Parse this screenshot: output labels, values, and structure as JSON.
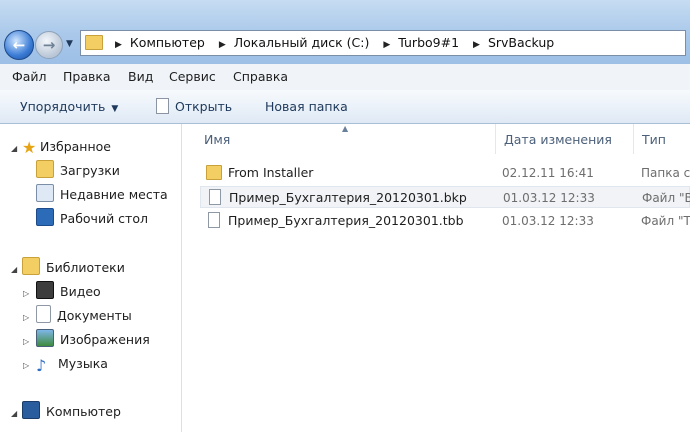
{
  "address": {
    "crumbs": [
      "Компьютер",
      "Локальный диск (C:)",
      "Turbo9#1",
      "SrvBackup"
    ]
  },
  "menu": {
    "file": "Файл",
    "edit": "Правка",
    "view": "Вид",
    "service": "Сервис",
    "help": "Справка"
  },
  "toolbar": {
    "organize": "Упорядочить",
    "open": "Открыть",
    "new_folder": "Новая папка"
  },
  "nav": {
    "favorites": "Избранное",
    "downloads": "Загрузки",
    "recent": "Недавние места",
    "desktop": "Рабочий стол",
    "libraries": "Библиотеки",
    "video": "Видео",
    "documents": "Документы",
    "images": "Изображения",
    "music": "Музыка",
    "computer": "Компьютер"
  },
  "columns": {
    "name": "Имя",
    "date": "Дата изменения",
    "type": "Тип"
  },
  "files": [
    {
      "name": "From Installer",
      "date": "02.12.11 16:41",
      "type": "Папка с"
    },
    {
      "name": "Пример_Бухгалтерия_20120301.bkp",
      "date": "01.03.12 12:33",
      "type": "Файл \"В"
    },
    {
      "name": "Пример_Бухгалтерия_20120301.tbb",
      "date": "01.03.12 12:33",
      "type": "Файл \"T"
    }
  ],
  "colors": {
    "titlebar": "#a9c8ea",
    "folder": "#f3cf63",
    "selection": "#f1f3f6"
  }
}
